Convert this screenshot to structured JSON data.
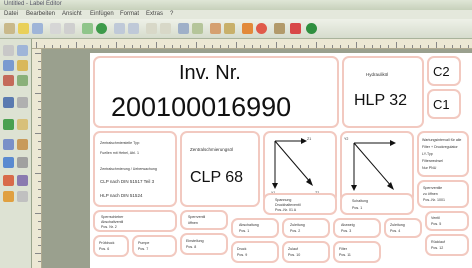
{
  "window": {
    "title": "Untitled - Label Editor"
  },
  "menu": [
    "Datei",
    "Bearbeiten",
    "Ansicht",
    "Einfügen",
    "Format",
    "Extras",
    "?"
  ],
  "colors": {
    "label_border": "#f2c9c0",
    "canvas_bg": "#9aa08e",
    "toolbar_bg": "#dde2d3"
  },
  "labels": {
    "inv_title": "Inv. Nr.",
    "inv_number": "200100016990",
    "hydraulik_caption": "Hydrauliköl",
    "hydraulik_value": "HLP 32",
    "c2": "C2",
    "c1": "C1",
    "schmier_lines": [
      "Zentralschmierstelle   Typ:",
      "Fuellen mit   Hebel, Abl. 1",
      "Zentralschmierung / Ueberwachung",
      "CLP nach DIN 51517 Teil 3",
      "HLP nach DIN 51524"
    ],
    "zentral_caption": "Zentralschmierungsöl",
    "zentral_value": "CLP 68",
    "arrow1": {
      "top": "Z1",
      "left": "Y1",
      "right": "Z2"
    },
    "arrow2": {
      "top": "Y2",
      "left": "Z3",
      "right": "Y3"
    },
    "wartung_lines": [
      "Wartungsintervall für alle",
      "Filter + Druckregulator",
      "LY-Typ",
      "Filterwechsel",
      "Nur PNU"
    ],
    "sperr_lines": [
      "Sperrventile",
      "zu öffnen",
      "Pos.-Nr. 1001"
    ],
    "spannung_lines": [
      "Spannung",
      "Druckhalteventil",
      "Pos.-Nr. 01 A"
    ],
    "middle_lines": [
      "Sperrschieber",
      "Abschaltventil",
      "Pos. Nr. 2"
    ],
    "dialog_lines": [
      "Schaltung",
      "Pos. 1"
    ],
    "row2": [
      {
        "line1": "Sperrventil",
        "line2": "öffnen"
      },
      {
        "line1": "Abschaltung",
        "line2": "Pos. 1"
      },
      {
        "line1": "Zuleitung",
        "line2": "Pos. 2"
      },
      {
        "line1": "Abzweig",
        "line2": "Pos. 3"
      },
      {
        "line1": "Zuleitung",
        "line2": "Pos. 4"
      },
      {
        "line1": "Ventil",
        "line2": "Pos. 5"
      }
    ],
    "row3": [
      {
        "line1": "Prüfdruck",
        "line2": "Pos. 6"
      },
      {
        "line1": "Pumpe",
        "line2": "Pos. 7"
      },
      {
        "line1": "Einstellung",
        "line2": "Pos. 8"
      },
      {
        "line1": "Druck",
        "line2": "Pos. 9"
      },
      {
        "line1": "Zulauf",
        "line2": "Pos. 10"
      },
      {
        "line1": "Filter",
        "line2": "Pos. 11"
      },
      {
        "line1": "Rücklauf",
        "line2": "Pos. 12"
      }
    ]
  }
}
